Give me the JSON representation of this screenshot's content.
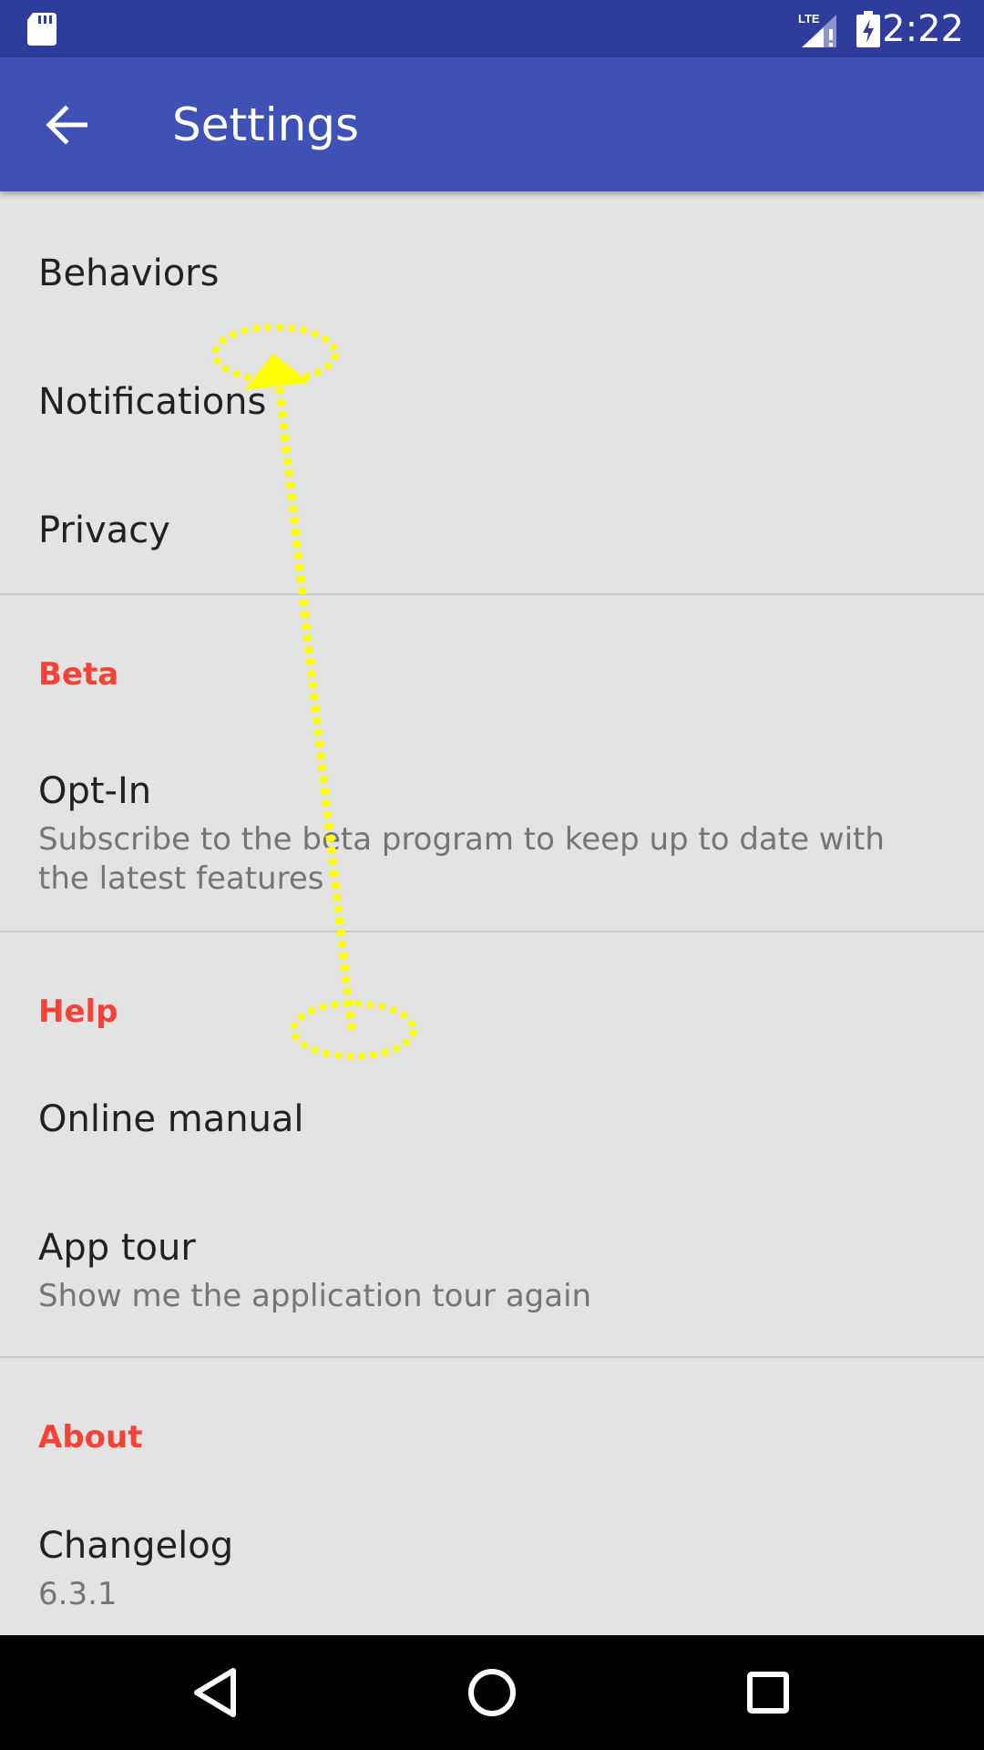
{
  "status_bar": {
    "time": "2:22",
    "network_label": "LTE",
    "icons": [
      "sd-card-icon",
      "lte-signal-icon",
      "battery-charging-icon"
    ]
  },
  "app_bar": {
    "title": "Settings",
    "back_icon": "arrow-back-icon"
  },
  "settings": {
    "general": [
      {
        "title": "Behaviors"
      },
      {
        "title": "Notifications"
      },
      {
        "title": "Privacy"
      }
    ],
    "beta": {
      "header": "Beta",
      "items": [
        {
          "title": "Opt-In",
          "summary": "Subscribe to the beta program to keep up to date with the latest features"
        }
      ]
    },
    "help": {
      "header": "Help",
      "items": [
        {
          "title": "Online manual"
        },
        {
          "title": "App tour",
          "summary": "Show me the application tour again"
        }
      ]
    },
    "about": {
      "header": "About",
      "items": [
        {
          "title": "Changelog",
          "summary": "6.3.1"
        }
      ]
    }
  },
  "gesture": {
    "type": "swipe-up",
    "color": "#ffff00"
  },
  "nav_bar": {
    "icons": [
      "back-triangle-icon",
      "home-circle-icon",
      "recents-square-icon"
    ]
  },
  "colors": {
    "status_bar": "#2f3c9b",
    "app_bar": "#3f51b5",
    "background": "#e3e3e3",
    "section_header": "#f44336",
    "title_text": "#212121",
    "summary_text": "#757575"
  }
}
